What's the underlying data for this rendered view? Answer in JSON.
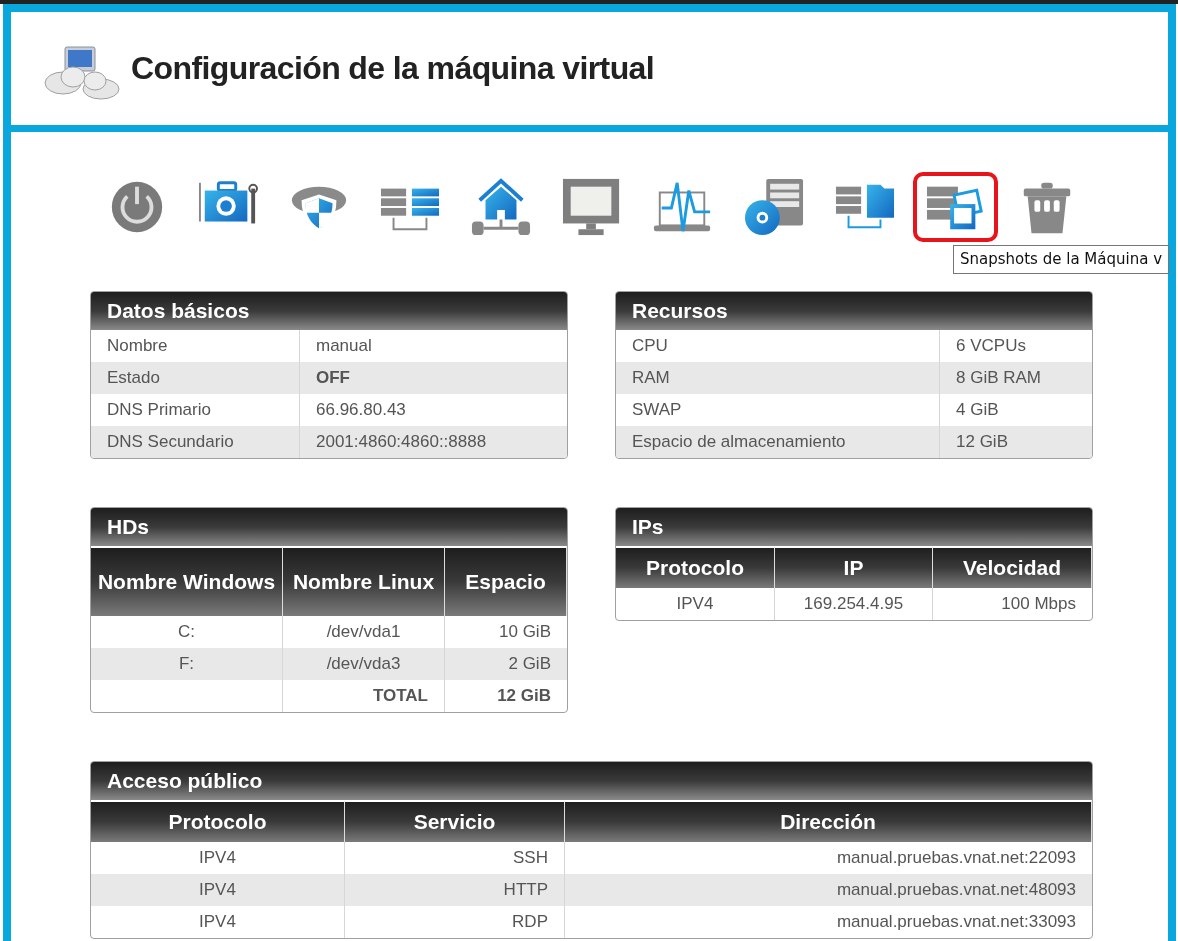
{
  "header": {
    "title": "Configuración de la máquina virtual"
  },
  "toolbar": {
    "items": [
      {
        "kind": "power",
        "selected": false
      },
      {
        "kind": "toolbox",
        "selected": false
      },
      {
        "kind": "cloud-shield",
        "selected": false
      },
      {
        "kind": "servers",
        "selected": false
      },
      {
        "kind": "home-network",
        "selected": false
      },
      {
        "kind": "monitor",
        "selected": false
      },
      {
        "kind": "laptop-pulse",
        "selected": false
      },
      {
        "kind": "disc-server",
        "selected": false
      },
      {
        "kind": "server-folder",
        "selected": false
      },
      {
        "kind": "snapshots",
        "selected": true
      },
      {
        "kind": "trash",
        "selected": false
      }
    ],
    "tooltip": "Snapshots de la Máquina v"
  },
  "basic": {
    "title": "Datos básicos",
    "rows": [
      {
        "label": "Nombre",
        "value": "manual",
        "strong": false
      },
      {
        "label": "Estado",
        "value": "OFF",
        "strong": true
      },
      {
        "label": "DNS Primario",
        "value": "66.96.80.43",
        "strong": false
      },
      {
        "label": "DNS Secundario",
        "value": "2001:4860:4860::8888",
        "strong": false
      }
    ]
  },
  "resources": {
    "title": "Recursos",
    "rows": [
      {
        "label": "CPU",
        "value": "6 VCPUs"
      },
      {
        "label": "RAM",
        "value": "8 GiB RAM"
      },
      {
        "label": "SWAP",
        "value": "4 GiB"
      },
      {
        "label": "Espacio de almacenamiento",
        "value": "12 GiB"
      }
    ]
  },
  "hds": {
    "title": "HDs",
    "columns": [
      "Nombre Windows",
      "Nombre Linux",
      "Espacio"
    ],
    "rows": [
      [
        "C:",
        "/dev/vda1",
        "10 GiB"
      ],
      [
        "F:",
        "/dev/vda3",
        "2 GiB"
      ]
    ],
    "total": {
      "label": "TOTAL",
      "value": "12 GiB"
    }
  },
  "ips": {
    "title": "IPs",
    "columns": [
      "Protocolo",
      "IP",
      "Velocidad"
    ],
    "rows": [
      [
        "IPV4",
        "169.254.4.95",
        "100 Mbps"
      ]
    ]
  },
  "public_access": {
    "title": "Acceso público",
    "columns": [
      "Protocolo",
      "Servicio",
      "Dirección"
    ],
    "rows": [
      [
        "IPV4",
        "SSH",
        "manual.pruebas.vnat.net:22093"
      ],
      [
        "IPV4",
        "HTTP",
        "manual.pruebas.vnat.net:48093"
      ],
      [
        "IPV4",
        "RDP",
        "manual.pruebas.vnat.net:33093"
      ]
    ]
  }
}
